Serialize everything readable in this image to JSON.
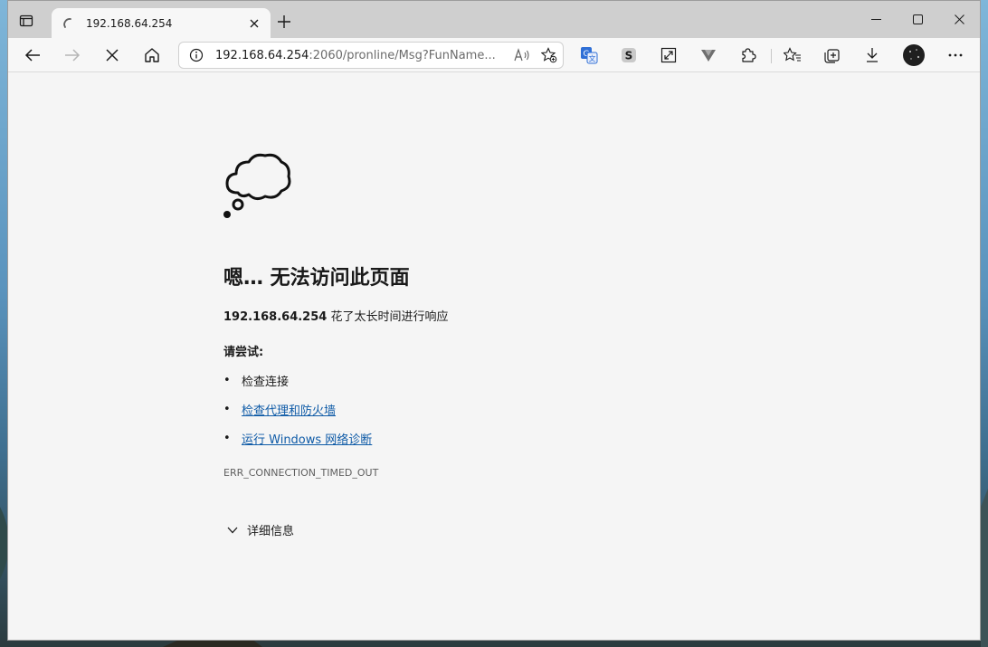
{
  "browser": {
    "tab": {
      "title": "192.168.64.254",
      "loading_icon": "spinner-icon",
      "close_icon": "close-icon"
    },
    "new_tab_icon": "plus-icon",
    "window_controls": [
      "minimize-icon",
      "maximize-icon",
      "close-icon"
    ],
    "toolbar": {
      "back_icon": "back-arrow-icon",
      "forward_icon": "forward-arrow-icon",
      "stop_icon": "stop-icon",
      "home_icon": "home-icon",
      "extensions": [
        "translate-icon",
        "s-extension-icon",
        "expand-icon",
        "v-extension-icon",
        "puzzle-icon",
        "favorites-icon",
        "collections-icon",
        "download-icon",
        "profile-avatar",
        "more-icon"
      ]
    },
    "address": {
      "host": "192.168.64.254",
      "rest": ":2060/pronline/Msg?FunName...",
      "info_icon": "info-icon",
      "read_aloud_icon": "read-aloud-icon",
      "favorite_add_icon": "add-favorite-icon"
    }
  },
  "error_page": {
    "icon": "thought-cloud-icon",
    "title": "嗯… 无法访问此页面",
    "host": "192.168.64.254",
    "description": " 花了太长时间进行响应",
    "try_label": "请尝试:",
    "suggestions": [
      {
        "text": "检查连接",
        "link": false
      },
      {
        "text": "检查代理和防火墙",
        "link": true
      },
      {
        "text": "运行 Windows 网络诊断",
        "link": true
      }
    ],
    "bullet": "•",
    "error_code": "ERR_CONNECTION_TIMED_OUT",
    "details_label": "详细信息"
  },
  "colors": {
    "link": "#0f5ba7",
    "page_bg": "#f5f5f5",
    "titlebar_bg": "#cfcfcf"
  }
}
